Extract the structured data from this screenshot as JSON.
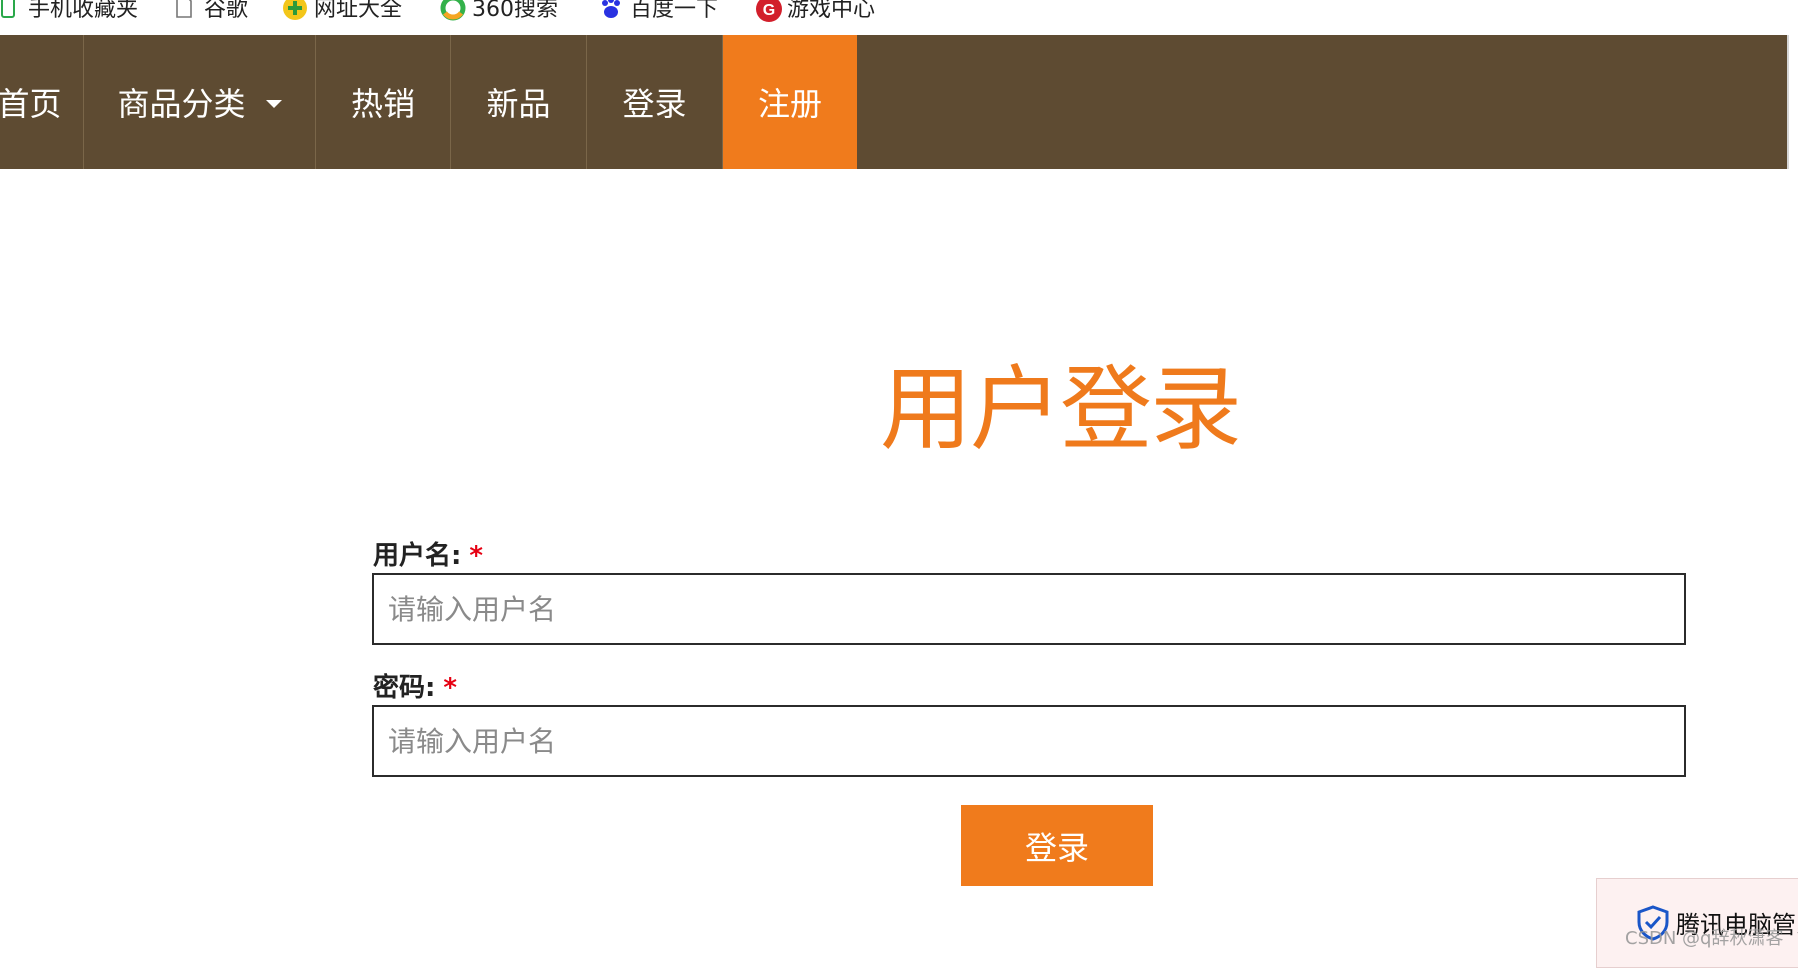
{
  "bookmarks": [
    {
      "label": "手机收藏夹",
      "icon": "phone-icon"
    },
    {
      "label": "谷歌",
      "icon": "page-icon"
    },
    {
      "label": "网址大全",
      "icon": "plus-circle-icon"
    },
    {
      "label": "360搜索",
      "icon": "360-icon"
    },
    {
      "label": "百度一下",
      "icon": "baidu-paw-icon"
    },
    {
      "label": "游戏中心",
      "icon": "game-icon"
    }
  ],
  "nav": {
    "items": [
      {
        "label": "首页"
      },
      {
        "label": "商品分类"
      },
      {
        "label": "热销"
      },
      {
        "label": "新品"
      },
      {
        "label": "登录"
      },
      {
        "label": "注册",
        "active": true
      }
    ],
    "bg_color": "#5e4b32",
    "active_color": "#f07b1c"
  },
  "page": {
    "title": "用户登录",
    "title_color": "#ef7a1c"
  },
  "form": {
    "username_label": "用户名:",
    "password_label": "密码:",
    "required_mark": "*",
    "username_placeholder": "请输入用户名",
    "password_placeholder": "请输入用户名",
    "submit_label": "登录"
  },
  "popup": {
    "text": "腾讯电脑管家",
    "icon": "shield-check-icon"
  },
  "watermark": "CSDN @q辞秋潇客"
}
